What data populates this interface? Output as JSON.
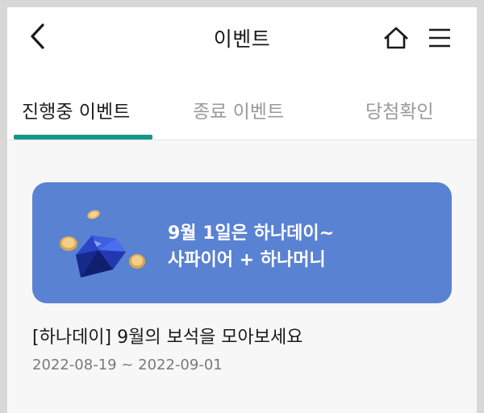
{
  "header": {
    "title": "이벤트",
    "back_icon": "chevron-left-icon",
    "home_icon": "home-icon",
    "menu_icon": "hamburger-menu-icon"
  },
  "tabs": [
    {
      "label": "진행중 이벤트",
      "active": true
    },
    {
      "label": "종료 이벤트",
      "active": false
    },
    {
      "label": "당첨확인",
      "active": false
    }
  ],
  "accent_color": "#16958a",
  "event": {
    "banner_line1": "9월 1일은 하나데이~",
    "banner_line2": "사파이어 + 하나머니",
    "banner_color": "#5a82d3",
    "title": "[하나데이] 9월의 보석을 모아보세요",
    "date_range": "2022-08-19 ~ 2022-09-01"
  }
}
